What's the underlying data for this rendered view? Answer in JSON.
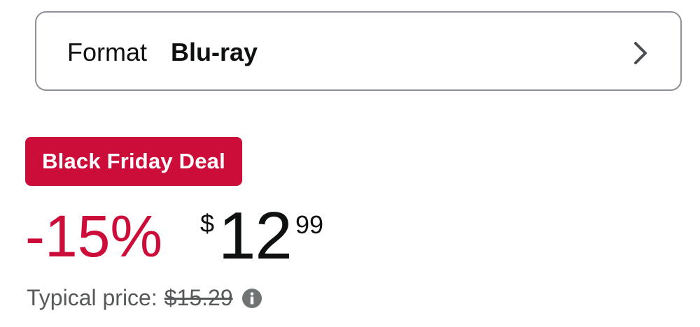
{
  "format": {
    "label": "Format",
    "value": "Blu-ray",
    "icon": "chevron-right-icon"
  },
  "deal": {
    "badge_label": "Black Friday Deal",
    "badge_color": "#cc0c39"
  },
  "price": {
    "discount": "-15%",
    "currency_symbol": "$",
    "whole": "12",
    "fraction": "99",
    "discount_color": "#cc0c39"
  },
  "typical_price": {
    "label": "Typical price:",
    "value": "$15.29",
    "icon": "info-icon"
  }
}
